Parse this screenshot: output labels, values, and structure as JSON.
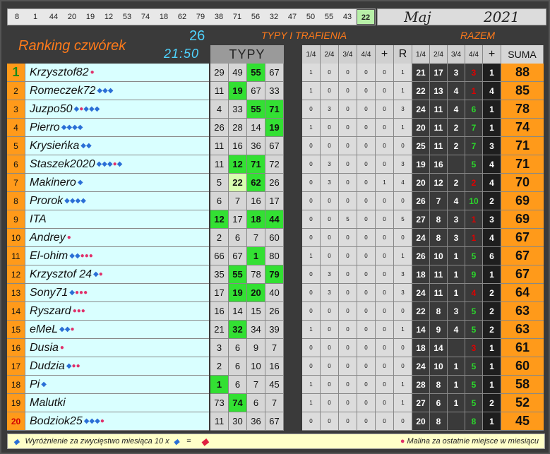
{
  "strip": [
    "8",
    "1",
    "44",
    "20",
    "19",
    "12",
    "53",
    "74",
    "18",
    "62",
    "79",
    "38",
    "71",
    "56",
    "32",
    "47",
    "50",
    "55",
    "43",
    "22"
  ],
  "strip_highlight_index": 19,
  "month": {
    "name": "Maj",
    "year": "2021"
  },
  "title": "Ranking czwórek",
  "draw_number": "26",
  "time": "21:50",
  "labels": {
    "typy_trafienia": "TYPY I TRAFIENIA",
    "razem": "RAZEM",
    "typy": "TYPY",
    "suma": "SUMA"
  },
  "traf_headers": [
    "1/4",
    "2/4",
    "3/4",
    "4/4",
    "+",
    "R"
  ],
  "razem_headers": [
    "1/4",
    "2/4",
    "3/4",
    "4/4",
    "+"
  ],
  "icons": {
    "diamond": "diamond-icon",
    "raspberry": "raspberry-icon",
    "gem": "gem-icon"
  },
  "rows": [
    {
      "pos": "1",
      "name": "Krzysztof82",
      "d": 0,
      "r": 1,
      "typy": [
        "29",
        "49",
        "55",
        "67"
      ],
      "tg": [
        2
      ],
      "tl": [],
      "traf": [
        "1",
        "0",
        "0",
        "0",
        "0",
        "1"
      ],
      "raz": [
        "21",
        "17",
        "3",
        "3",
        "1"
      ],
      "suma": "88"
    },
    {
      "pos": "2",
      "name": "Romeczek72",
      "d": 3,
      "r": 0,
      "typy": [
        "11",
        "19",
        "67",
        "33"
      ],
      "tg": [
        1
      ],
      "tl": [],
      "traf": [
        "1",
        "0",
        "0",
        "0",
        "0",
        "1"
      ],
      "raz": [
        "22",
        "13",
        "4",
        "1",
        "4"
      ],
      "suma": "85"
    },
    {
      "pos": "3",
      "name": "Juzpo50",
      "d": 1,
      "r": 1,
      "d2": 3,
      "typy": [
        "4",
        "33",
        "55",
        "71"
      ],
      "tg": [
        2,
        3
      ],
      "tl": [],
      "traf": [
        "0",
        "3",
        "0",
        "0",
        "0",
        "3"
      ],
      "raz": [
        "24",
        "11",
        "4",
        "6",
        "1"
      ],
      "suma": "78"
    },
    {
      "pos": "4",
      "name": "Pierro",
      "d": 4,
      "r": 0,
      "typy": [
        "26",
        "28",
        "14",
        "19"
      ],
      "tg": [
        3
      ],
      "tl": [],
      "traf": [
        "1",
        "0",
        "0",
        "0",
        "0",
        "1"
      ],
      "raz": [
        "20",
        "11",
        "2",
        "7",
        "1"
      ],
      "suma": "74"
    },
    {
      "pos": "5",
      "name": "Krysieńka",
      "d": 2,
      "r": 0,
      "typy": [
        "11",
        "16",
        "36",
        "67"
      ],
      "tg": [],
      "tl": [],
      "traf": [
        "0",
        "0",
        "0",
        "0",
        "0",
        "0"
      ],
      "raz": [
        "25",
        "11",
        "2",
        "7",
        "3"
      ],
      "suma": "71"
    },
    {
      "pos": "6",
      "name": "Staszek2020",
      "d": 3,
      "r": 1,
      "d2": 1,
      "typy": [
        "11",
        "12",
        "71",
        "72"
      ],
      "tg": [
        1,
        2
      ],
      "tl": [],
      "traf": [
        "0",
        "3",
        "0",
        "0",
        "0",
        "3"
      ],
      "raz": [
        "19",
        "16",
        "",
        "5",
        "4"
      ],
      "suma": "71"
    },
    {
      "pos": "7",
      "name": "Makinero",
      "d": 1,
      "r": 0,
      "typy": [
        "5",
        "22",
        "62",
        "26"
      ],
      "tg": [
        2
      ],
      "tl": [
        1
      ],
      "traf": [
        "0",
        "3",
        "0",
        "0",
        "1",
        "4"
      ],
      "raz": [
        "20",
        "12",
        "2",
        "2",
        "4"
      ],
      "suma": "70"
    },
    {
      "pos": "8",
      "name": "Prorok",
      "d": 4,
      "r": 0,
      "typy": [
        "6",
        "7",
        "16",
        "17"
      ],
      "tg": [],
      "tl": [],
      "traf": [
        "0",
        "0",
        "0",
        "0",
        "0",
        "0"
      ],
      "raz": [
        "26",
        "7",
        "4",
        "10",
        "2"
      ],
      "suma": "69"
    },
    {
      "pos": "9",
      "name": "ITA",
      "d": 0,
      "r": 0,
      "typy": [
        "12",
        "17",
        "18",
        "44"
      ],
      "tg": [
        0,
        2,
        3
      ],
      "tl": [],
      "traf": [
        "0",
        "0",
        "5",
        "0",
        "0",
        "5"
      ],
      "raz": [
        "27",
        "8",
        "3",
        "1",
        "3"
      ],
      "suma": "69"
    },
    {
      "pos": "10",
      "name": "Andrey",
      "d": 0,
      "r": 1,
      "typy": [
        "2",
        "6",
        "7",
        "60"
      ],
      "tg": [],
      "tl": [],
      "traf": [
        "0",
        "0",
        "0",
        "0",
        "0",
        "0"
      ],
      "raz": [
        "24",
        "8",
        "3",
        "1",
        "4"
      ],
      "suma": "67"
    },
    {
      "pos": "11",
      "name": "El-ohim",
      "d": 2,
      "r": 3,
      "typy": [
        "66",
        "67",
        "1",
        "80"
      ],
      "tg": [
        2
      ],
      "tl": [],
      "traf": [
        "1",
        "0",
        "0",
        "0",
        "0",
        "1"
      ],
      "raz": [
        "26",
        "10",
        "1",
        "5",
        "6"
      ],
      "suma": "67"
    },
    {
      "pos": "12",
      "name": "Krzysztof 24",
      "d": 1,
      "r": 1,
      "typy": [
        "35",
        "55",
        "78",
        "79"
      ],
      "tg": [
        1,
        3
      ],
      "tl": [],
      "traf": [
        "0",
        "3",
        "0",
        "0",
        "0",
        "3"
      ],
      "raz": [
        "18",
        "11",
        "1",
        "9",
        "1"
      ],
      "suma": "67"
    },
    {
      "pos": "13",
      "name": "Sony71",
      "d": 1,
      "r": 3,
      "typy": [
        "17",
        "19",
        "20",
        "40"
      ],
      "tg": [
        1,
        2
      ],
      "tl": [],
      "traf": [
        "0",
        "3",
        "0",
        "0",
        "0",
        "3"
      ],
      "raz": [
        "24",
        "11",
        "1",
        "4",
        "2"
      ],
      "suma": "64"
    },
    {
      "pos": "14",
      "name": "Ryszard",
      "d": 0,
      "r": 3,
      "typy": [
        "16",
        "14",
        "15",
        "26"
      ],
      "tg": [],
      "tl": [],
      "traf": [
        "0",
        "0",
        "0",
        "0",
        "0",
        "0"
      ],
      "raz": [
        "22",
        "8",
        "3",
        "5",
        "2"
      ],
      "suma": "63"
    },
    {
      "pos": "15",
      "name": "eMeL",
      "d": 2,
      "r": 1,
      "typy": [
        "21",
        "32",
        "34",
        "39"
      ],
      "tg": [
        1
      ],
      "tl": [],
      "traf": [
        "1",
        "0",
        "0",
        "0",
        "0",
        "1"
      ],
      "raz": [
        "14",
        "9",
        "4",
        "5",
        "2"
      ],
      "suma": "63"
    },
    {
      "pos": "16",
      "name": "Dusia",
      "d": 0,
      "r": 1,
      "typy": [
        "3",
        "6",
        "9",
        "7"
      ],
      "tg": [],
      "tl": [],
      "traf": [
        "0",
        "0",
        "0",
        "0",
        "0",
        "0"
      ],
      "raz": [
        "18",
        "14",
        "",
        "3",
        "1"
      ],
      "suma": "61"
    },
    {
      "pos": "17",
      "name": "Dudzia",
      "d": 1,
      "r": 2,
      "typy": [
        "2",
        "6",
        "10",
        "16"
      ],
      "tg": [],
      "tl": [],
      "traf": [
        "0",
        "0",
        "0",
        "0",
        "0",
        "0"
      ],
      "raz": [
        "24",
        "10",
        "1",
        "5",
        "1"
      ],
      "suma": "60"
    },
    {
      "pos": "18",
      "name": "Pi",
      "d": 1,
      "r": 0,
      "typy": [
        "1",
        "6",
        "7",
        "45"
      ],
      "tg": [
        0
      ],
      "tl": [],
      "traf": [
        "1",
        "0",
        "0",
        "0",
        "0",
        "1"
      ],
      "raz": [
        "28",
        "8",
        "1",
        "5",
        "1"
      ],
      "suma": "58"
    },
    {
      "pos": "19",
      "name": "Malutki",
      "d": 0,
      "r": 0,
      "typy": [
        "73",
        "74",
        "6",
        "7"
      ],
      "tg": [
        1
      ],
      "tl": [],
      "traf": [
        "1",
        "0",
        "0",
        "0",
        "0",
        "1"
      ],
      "raz": [
        "27",
        "6",
        "1",
        "5",
        "2"
      ],
      "suma": "52"
    },
    {
      "pos": "20",
      "name": "Bodziok25",
      "d": 3,
      "r": 1,
      "typy": [
        "11",
        "30",
        "36",
        "67"
      ],
      "tg": [],
      "tl": [],
      "traf": [
        "0",
        "0",
        "0",
        "0",
        "0",
        "0"
      ],
      "raz": [
        "20",
        "8",
        "",
        "8",
        "1"
      ],
      "suma": "45"
    }
  ],
  "footer": {
    "left": "Wyróżnienie za zwycięstwo miesiąca  10 x",
    "equals": "=",
    "right": "Malina za ostatnie miejsce w miesiącu"
  }
}
